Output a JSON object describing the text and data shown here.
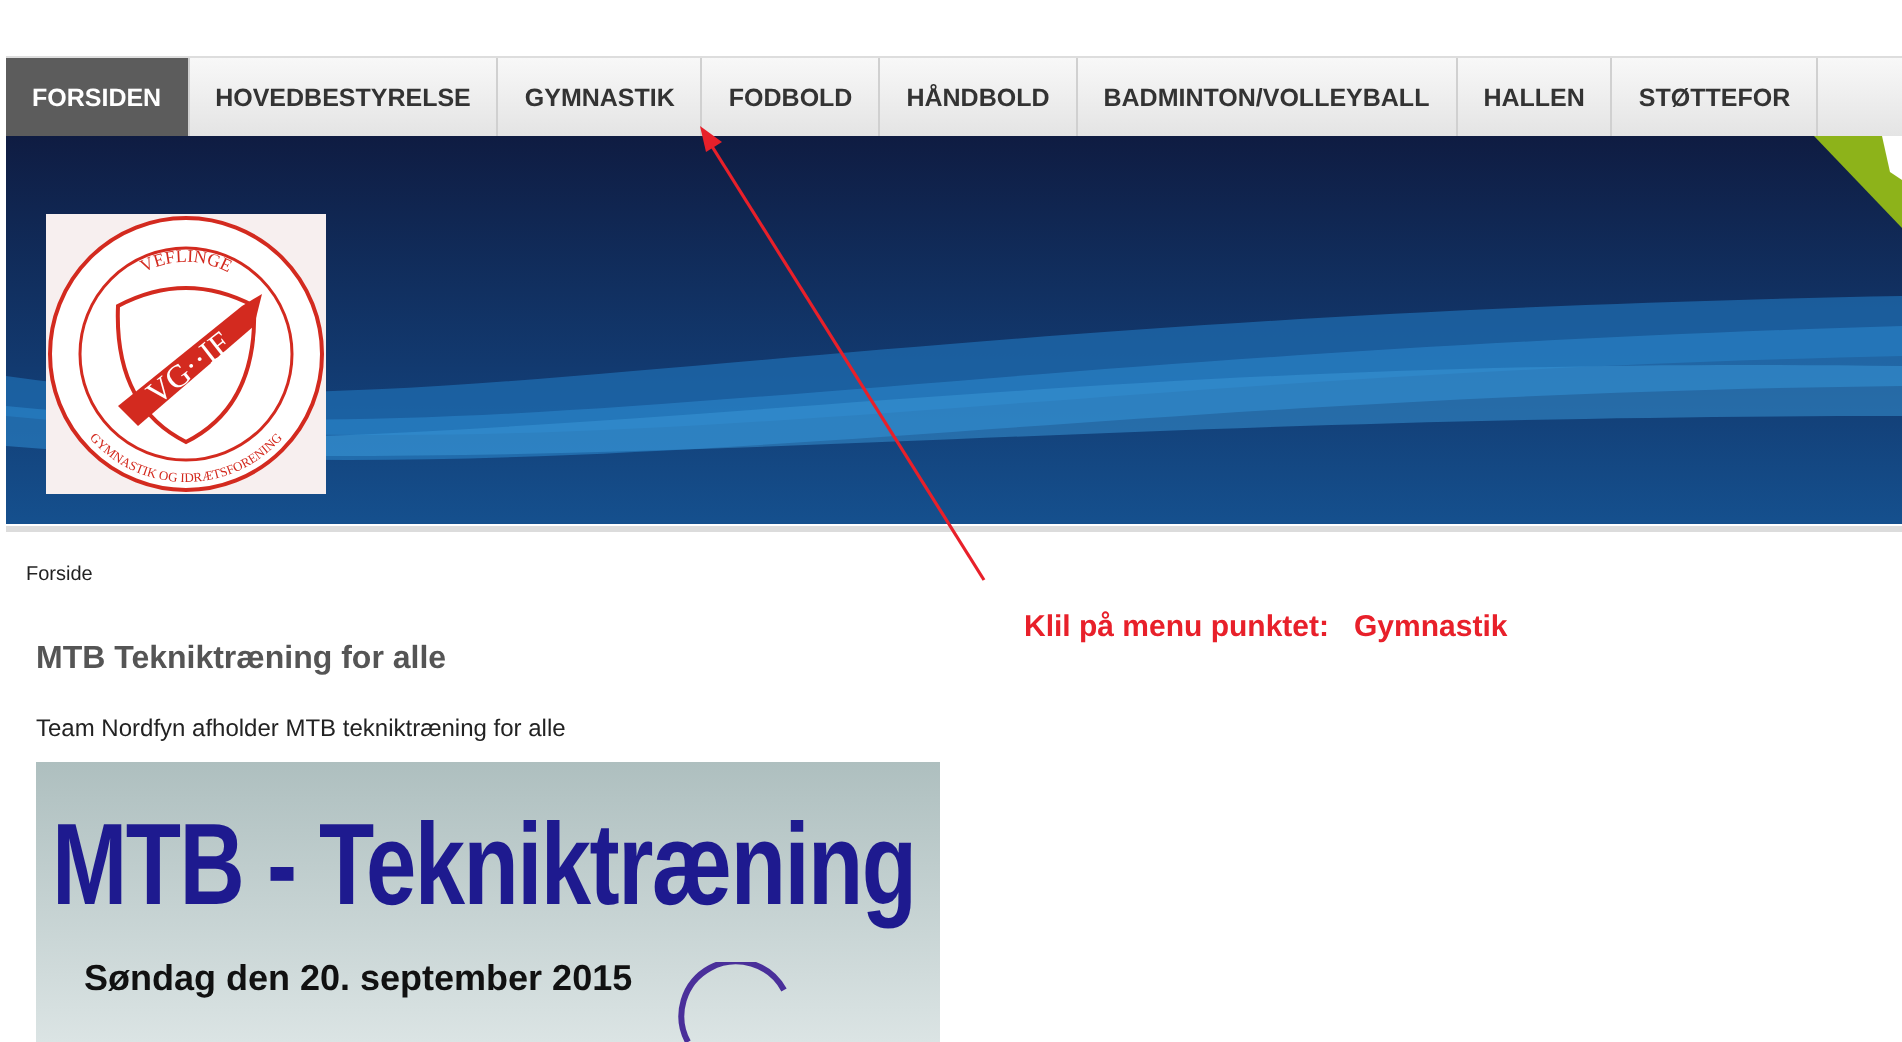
{
  "nav": [
    {
      "label": "FORSIDEN",
      "selected": true
    },
    {
      "label": "HOVEDBESTYRELSE",
      "selected": false
    },
    {
      "label": "GYMNASTIK",
      "selected": false
    },
    {
      "label": "FODBOLD",
      "selected": false
    },
    {
      "label": "HÅNDBOLD",
      "selected": false
    },
    {
      "label": "BADMINTON/VOLLEYBALL",
      "selected": false
    },
    {
      "label": "HALLEN",
      "selected": false
    },
    {
      "label": "STØTTEFOR",
      "selected": false
    }
  ],
  "logo": {
    "top_text": "VEFLINGE",
    "initials": "VG··IF",
    "bottom_text": "GYMNASTIK OG IDRÆTSFORENING"
  },
  "breadcrumb": "Forside",
  "article": {
    "title": "MTB Tekniktræning for alle",
    "intro": "Team Nordfyn afholder MTB tekniktræning for alle",
    "poster": {
      "title": "MTB - Tekniktræning",
      "date": "Søndag den 20. september 2015"
    }
  },
  "annotation": {
    "label": "Klil på menu punktet:   Gymnastik"
  }
}
